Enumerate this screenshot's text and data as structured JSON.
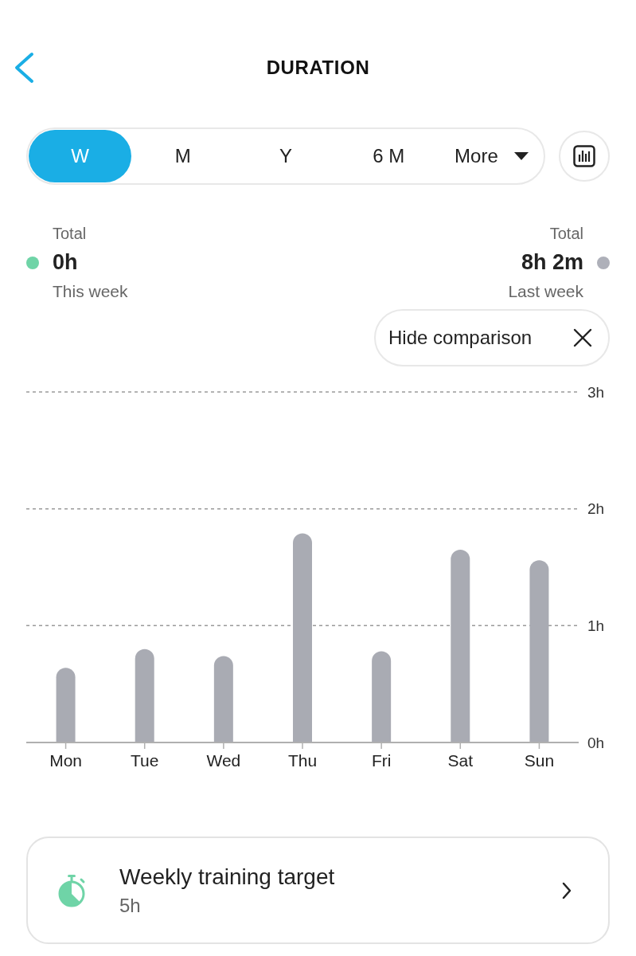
{
  "header": {
    "title": "DURATION"
  },
  "period_tabs": [
    {
      "label": "W",
      "selected": true,
      "kind": "tab"
    },
    {
      "label": "M",
      "selected": false,
      "kind": "tab"
    },
    {
      "label": "Y",
      "selected": false,
      "kind": "tab"
    },
    {
      "label": "6 M",
      "selected": false,
      "kind": "tab"
    },
    {
      "label": "More",
      "selected": false,
      "kind": "dropdown"
    }
  ],
  "totals": [
    {
      "label": "Total",
      "value": "0h",
      "caption": "This week",
      "color": "#6fd4a7"
    },
    {
      "label": "Total",
      "value": "8h 2m",
      "caption": "Last week",
      "color": "#aeb0b9"
    }
  ],
  "comparison_toggle": {
    "label": "Hide comparison"
  },
  "chart": {
    "chart_data": {
      "type": "bar",
      "categories": [
        "Mon",
        "Tue",
        "Wed",
        "Thu",
        "Fri",
        "Sat",
        "Sun"
      ],
      "series": [
        {
          "color": "#a9abb3",
          "values": [
            0.64,
            0.8,
            0.74,
            1.79,
            0.78,
            1.65,
            1.56
          ]
        }
      ],
      "ylim": [
        0,
        3
      ],
      "yticks": [
        {
          "value": 0,
          "label": "0h"
        },
        {
          "value": 1,
          "label": "1h"
        },
        {
          "value": 2,
          "label": "2h"
        },
        {
          "value": 3,
          "label": "3h"
        }
      ]
    }
  },
  "target_card": {
    "title": "Weekly training target",
    "value": "5h"
  }
}
